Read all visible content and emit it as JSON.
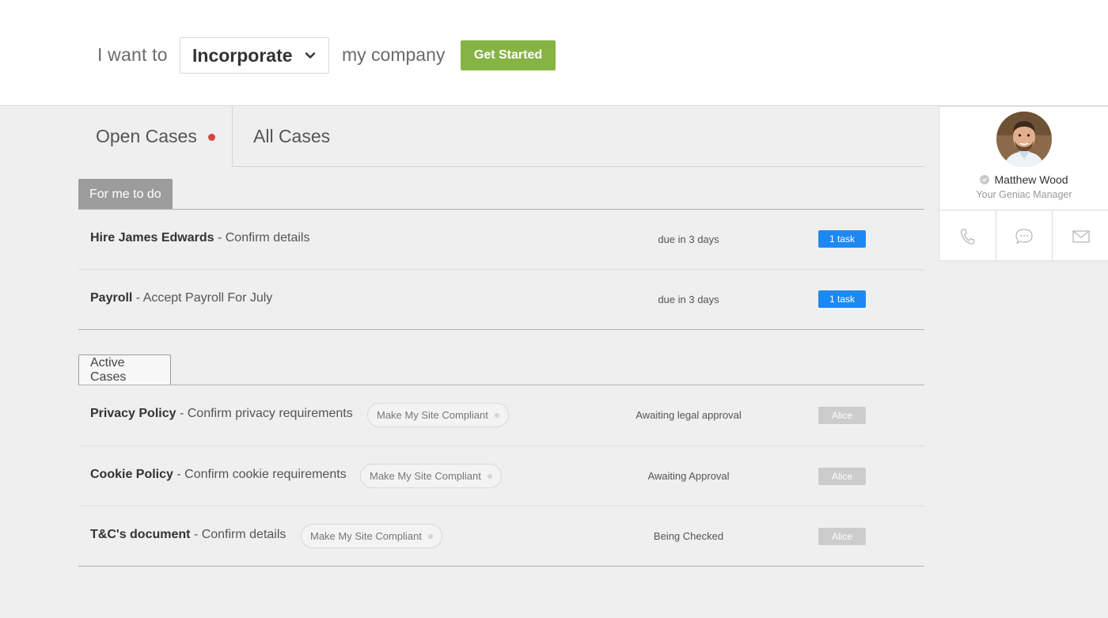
{
  "header": {
    "prefix": "I want to",
    "select_value": "Incorporate",
    "suffix": "my company",
    "cta_label": "Get Started"
  },
  "tabs": [
    {
      "label": "Open Cases",
      "active": true,
      "has_dot": true
    },
    {
      "label": "All Cases",
      "active": false,
      "has_dot": false
    }
  ],
  "sections": {
    "todo": {
      "label": "For me to do",
      "rows": [
        {
          "title": "Hire James Edwards",
          "desc": " - Confirm details",
          "status": "due in 3 days",
          "badge": "1 task"
        },
        {
          "title": "Payroll",
          "desc": " - Accept Payroll For July",
          "status": "due in 3 days",
          "badge": "1 task"
        }
      ]
    },
    "active": {
      "label": "Active Cases",
      "rows": [
        {
          "title": "Privacy Policy",
          "desc": " - Confirm privacy requirements",
          "pill": "Make My Site Compliant",
          "status": "Awaiting legal approval",
          "assignee": "Alice"
        },
        {
          "title": "Cookie Policy",
          "desc": " - Confirm cookie requirements",
          "pill": "Make My Site Compliant",
          "status": "Awaiting Approval",
          "assignee": "Alice"
        },
        {
          "title": "T&C's document",
          "desc": " - Confirm details",
          "pill": "Make My Site Compliant",
          "status": "Being Checked",
          "assignee": "Alice"
        }
      ]
    }
  },
  "manager": {
    "name": "Matthew Wood",
    "role": "Your Geniac Manager",
    "actions": [
      "phone-icon",
      "chat-icon",
      "mail-icon"
    ]
  },
  "colors": {
    "accent_green": "#86b444",
    "task_blue": "#1e88f2",
    "alert_dot": "#d8453f"
  }
}
